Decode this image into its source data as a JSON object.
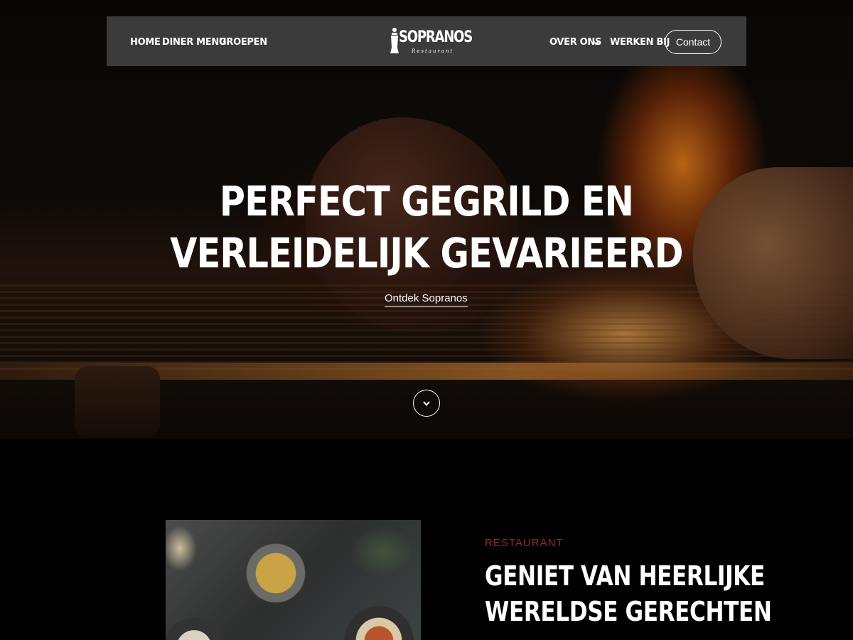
{
  "nav": {
    "home": "HOME",
    "diner_menu": "DINER MENU",
    "groepen": "GROEPEN",
    "over_ons": "OVER ONS",
    "werken_bij": "WERKEN BIJ",
    "contact": "Contact"
  },
  "logo": {
    "name": "SOPRANOS",
    "subtitle": "Restaurant"
  },
  "hero": {
    "headline_line1": "PERFECT GEGRILD EN",
    "headline_line2": "VERLEIDELIJK GEVARIEERD",
    "cta": "Ontdek Sopranos"
  },
  "section": {
    "eyebrow": "RESTAURANT",
    "title_line1": "GENIET VAN HEERLIJKE",
    "title_line2": "WERELDSE GERECHTEN"
  },
  "colors": {
    "nav_bg": "#3b3b3b",
    "eyebrow": "#8e2f25",
    "page_bg": "#000000"
  },
  "icons": [
    "chevron-down-icon",
    "scroll-down-icon"
  ]
}
